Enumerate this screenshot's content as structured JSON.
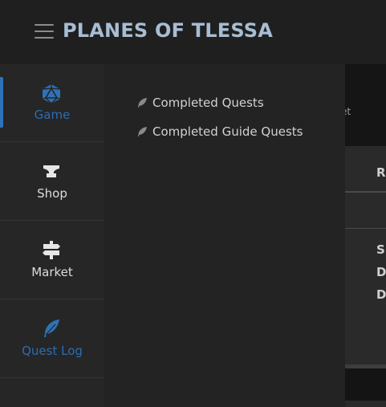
{
  "app": {
    "title": "PLANES OF TLESSA"
  },
  "header": {
    "menu_icon": "hamburger-menu-icon"
  },
  "sidebar": {
    "items": [
      {
        "label": "Game",
        "icon": "d20-dice-icon",
        "active": true
      },
      {
        "label": "Shop",
        "icon": "anvil-icon",
        "active": false
      },
      {
        "label": "Market",
        "icon": "signpost-icon",
        "active": false
      },
      {
        "label": "Quest Log",
        "icon": "feather-icon",
        "active": false
      }
    ]
  },
  "flyout": {
    "items": [
      {
        "label": "Completed Quests",
        "icon": "feather-icon"
      },
      {
        "label": "Completed Guide Quests",
        "icon": "feather-icon"
      }
    ]
  },
  "background_page": {
    "top_text": "et",
    "column_header": "R",
    "stats": [
      "S",
      "D",
      "D"
    ]
  },
  "colors": {
    "accent": "#2f72b8",
    "title": "#a7bdd3",
    "sidebar_bg": "#262626",
    "header_bg": "#1f1f1f"
  }
}
